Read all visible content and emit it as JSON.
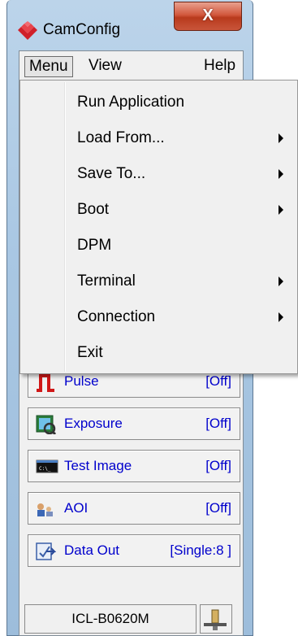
{
  "window": {
    "title": "CamConfig",
    "close_label": "X"
  },
  "menubar": {
    "items": [
      "Menu",
      "View",
      "Help"
    ]
  },
  "dropdown": {
    "items": [
      {
        "label": "Run Application",
        "submenu": false
      },
      {
        "label": "Load From...",
        "submenu": true
      },
      {
        "label": "Save To...",
        "submenu": true
      },
      {
        "label": "Boot",
        "submenu": true
      },
      {
        "label": "DPM",
        "submenu": false
      },
      {
        "label": "Terminal",
        "submenu": true
      },
      {
        "label": "Connection",
        "submenu": true
      },
      {
        "label": "Exit",
        "submenu": false
      }
    ]
  },
  "features": [
    {
      "label": "Pulse",
      "status": "[Off]",
      "icon": "pulse-icon"
    },
    {
      "label": "Exposure",
      "status": "[Off]",
      "icon": "exposure-icon"
    },
    {
      "label": "Test Image",
      "status": "[Off]",
      "icon": "test-image-icon"
    },
    {
      "label": "AOI",
      "status": "[Off]",
      "icon": "aoi-icon"
    },
    {
      "label": "Data Out",
      "status": "[Single:8 ]",
      "icon": "data-out-icon"
    }
  ],
  "status": {
    "camera_model": "ICL-B0620M"
  },
  "colors": {
    "link_text": "#0000cc",
    "logo_red": "#d0202a",
    "close_red": "#c9553a"
  }
}
